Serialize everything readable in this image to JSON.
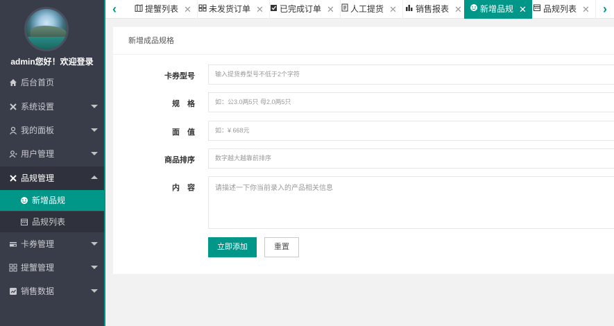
{
  "user": {
    "greeting": "admin您好！欢迎登录"
  },
  "sidebar": {
    "items": [
      {
        "label": "后台首页",
        "icon": "home-icon"
      },
      {
        "label": "系统设置",
        "icon": "tools-icon"
      },
      {
        "label": "我的面板",
        "icon": "user-icon"
      },
      {
        "label": "用户管理",
        "icon": "users-icon"
      },
      {
        "label": "品规管理",
        "icon": "tools-icon"
      },
      {
        "label": "卡券管理",
        "icon": "card-icon"
      },
      {
        "label": "提蟹管理",
        "icon": "grid-icon"
      },
      {
        "label": "销售数据",
        "icon": "chart-icon"
      }
    ],
    "subitems": [
      {
        "label": "新增品规",
        "icon": "smile-icon"
      },
      {
        "label": "品规列表",
        "icon": "calendar-icon"
      }
    ]
  },
  "tabs": [
    {
      "label": "提蟹列表",
      "icon": "map-icon"
    },
    {
      "label": "未发货订单",
      "icon": "truck-icon"
    },
    {
      "label": "已完成订单",
      "icon": "check-doc-icon"
    },
    {
      "label": "人工提货",
      "icon": "doc-icon"
    },
    {
      "label": "销售报表",
      "icon": "bar-chart-icon"
    },
    {
      "label": "新增品规",
      "icon": "smile-icon"
    },
    {
      "label": "品规列表",
      "icon": "calendar-icon"
    }
  ],
  "tab_close": "✕",
  "tab_nav": {
    "prev": "‹",
    "next": "›"
  },
  "form": {
    "title": "新增成品规格",
    "fields": [
      {
        "label": "卡券型号",
        "placeholder": "输入提货券型号不低于2个字符"
      },
      {
        "label": "规　格",
        "placeholder": "如：公3.0两5只 母2.0两5只"
      },
      {
        "label": "面　值",
        "placeholder": "如：¥ 668元"
      },
      {
        "label": "商品排序",
        "placeholder": "数字越大越靠前排序"
      },
      {
        "label": "内　容",
        "placeholder": "请描述一下你当前录入的产品相关信息"
      }
    ],
    "submit_label": "立即添加",
    "reset_label": "重置"
  },
  "colors": {
    "accent": "#009688",
    "sidebar_bg": "#393d49"
  }
}
